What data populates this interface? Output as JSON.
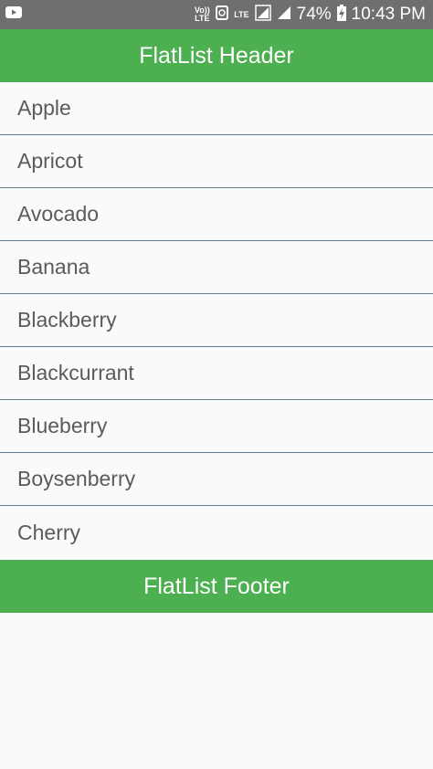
{
  "status_bar": {
    "volte_label": "Vo)) LTE",
    "lte_label": "LTE",
    "battery": "74%",
    "time": "10:43 PM"
  },
  "header": {
    "title": "FlatList Header"
  },
  "list": {
    "items": [
      "Apple",
      "Apricot",
      "Avocado",
      "Banana",
      "Blackberry",
      "Blackcurrant",
      "Blueberry",
      "Boysenberry",
      "Cherry"
    ]
  },
  "footer": {
    "title": "FlatList Footer"
  },
  "colors": {
    "header_bg": "#4caf50",
    "separator": "#607d8b",
    "status_bar_bg": "#6f6f6f",
    "text": "#5b5b5b"
  }
}
